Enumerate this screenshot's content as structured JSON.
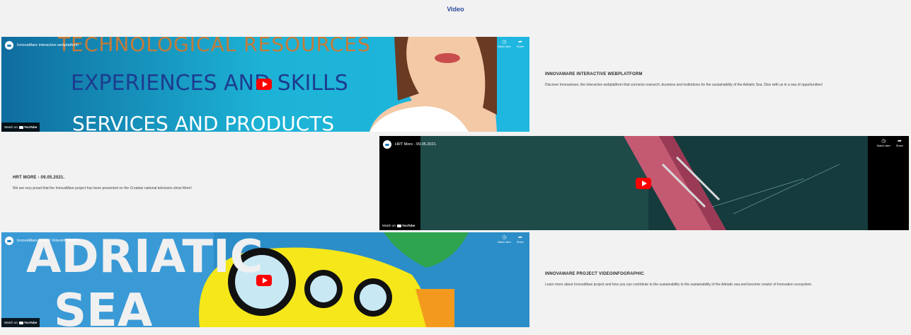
{
  "section": {
    "title": "Video"
  },
  "videos": [
    {
      "channel_title": "InnovaMare interactive webplatform",
      "overlay_lines": [
        "TECHNOLOGICAL RESOURCES",
        "EXPERIENCES AND SKILLS",
        "SERVICES AND PRODUCTS"
      ],
      "watch_later": "Watch later",
      "share": "Share",
      "watch_on": "Watch on",
      "youtube": "YouTube",
      "heading": "INNOVAMARE INTERACTIVE WEBPLATFORM",
      "description": "Discover Innovamare, the interactive webplatform that connects research, business and institutions for the sustainability of the Adriatic Sea. Dive with us in a sea of opportunities!"
    },
    {
      "channel_title": "HRT More - 09.05.2021.",
      "watch_later": "Watch later",
      "share": "Share",
      "watch_on": "Watch on",
      "youtube": "YouTube",
      "heading": "HRT MORE - 09.05.2021.",
      "description": "We are very proud that the InnovaMare project has been presented on the Croatian national television show More!"
    },
    {
      "channel_title": "InnovaMare project Videoinfographic",
      "overlay_lines": [
        "ADRIATIC",
        "SEA"
      ],
      "watch_later": "Watch later",
      "share": "Share",
      "watch_on": "Watch on",
      "youtube": "YouTube",
      "heading": "INNOVAMARE PROJECT VIDEOINFOGRAPHIC",
      "description": "Learn more about InnovaMare project and how you can contribute to the sustainability to the sustainability of the Adriatic sea and become creator of innovation ecosystem."
    }
  ],
  "colors": {
    "accent": "#2b4a9a",
    "youtube_red": "#ff0000"
  },
  "icons": [
    "clock-icon",
    "share-icon",
    "play-icon",
    "youtube-logo-icon"
  ]
}
